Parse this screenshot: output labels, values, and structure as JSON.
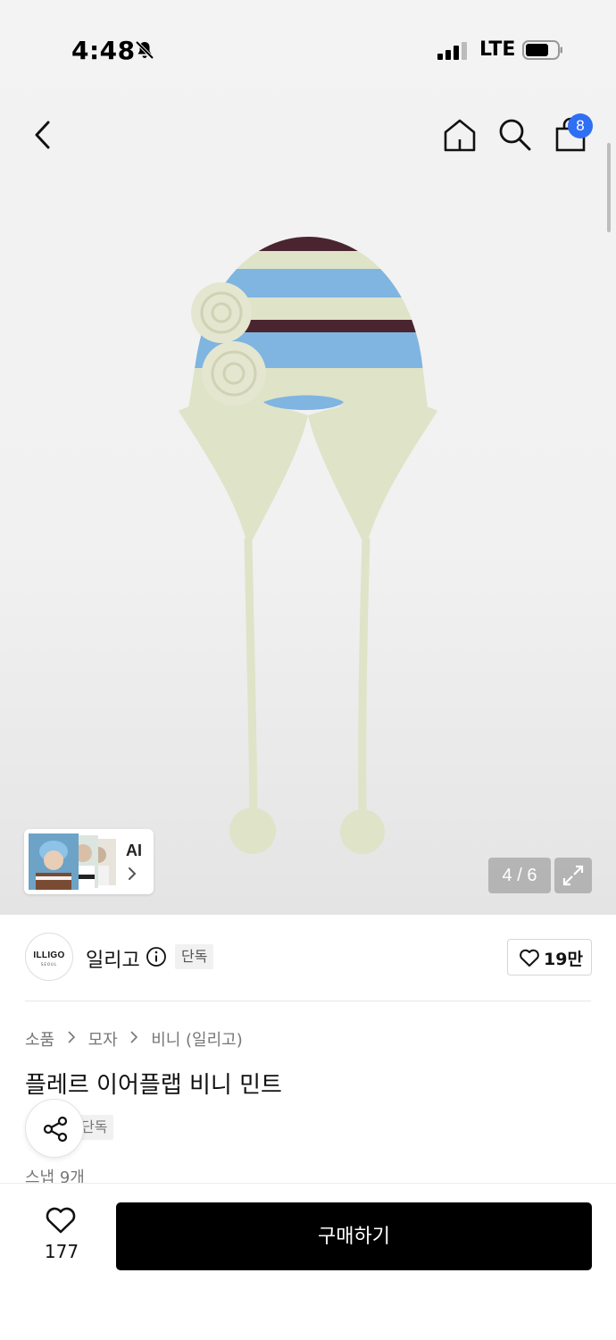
{
  "status_bar": {
    "time": "4:48",
    "network": "LTE",
    "icons": [
      "bell-off-icon",
      "signal-icon",
      "battery-icon"
    ]
  },
  "nav": {
    "icons": [
      "back-icon",
      "home-icon",
      "search-icon",
      "cart-icon"
    ],
    "cart_badge": "8",
    "accent_color": "#2f6ff3"
  },
  "gallery": {
    "ai_label": "AI",
    "page_counter": "4 / 6"
  },
  "brand": {
    "logo_text": "ILLIGO",
    "logo_subtext": "SEOUL",
    "name": "일리고",
    "tag": "단독",
    "likes": "19만"
  },
  "product": {
    "breadcrumb": [
      "소품",
      "모자",
      "비니 (일리고)"
    ],
    "title": "플레르 이어플랩 비니 민트",
    "tag": "단독",
    "snap_count": "스냅 9개"
  },
  "bottom_bar": {
    "wish_count": "177",
    "buy_label": "구매하기"
  }
}
